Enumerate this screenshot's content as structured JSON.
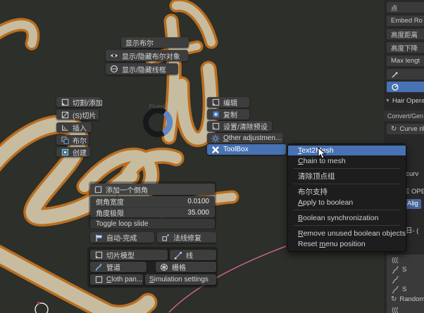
{
  "colors": {
    "highlight_blue": "#4772b3",
    "letter_cream": "#d5c8a9",
    "letter_orange": "#c8741f",
    "pink_curve": "#cb6287",
    "pie_arc_blue": "#5d87c6"
  },
  "pie": {
    "label": "Fluent菜单"
  },
  "top_buttons": [
    {
      "label": "显示布尔",
      "icon": null
    },
    {
      "label": "显示/隐藏布尔对象",
      "icon": "eye-icon"
    },
    {
      "label": "显示/隐藏线框",
      "icon": "wire-circle-icon"
    }
  ],
  "left_menu": [
    {
      "label": "切割/添加",
      "icon": "cut-add-icon"
    },
    {
      "label": "(S)切片",
      "icon": "slice-icon"
    },
    {
      "label": "插入",
      "icon": "inset-icon"
    },
    {
      "label": "布尔",
      "icon": "boolean-icon"
    },
    {
      "label": "创建",
      "icon": "create-icon"
    }
  ],
  "mid_menu": [
    {
      "label": "编辑",
      "icon": "edit-icon"
    },
    {
      "label": "复制",
      "icon": "duplicate-icon"
    },
    {
      "label": "设置/清除预设",
      "icon": "preset-icon"
    },
    {
      "label": "Other adjustmen...",
      "icon": "gear-icon",
      "accel": "O"
    },
    {
      "label": "ToolBox",
      "icon": "toolbox-icon",
      "highlighted": true
    }
  ],
  "submenu": [
    {
      "type": "item",
      "label": "Text2Mesh",
      "accel": "T",
      "highlighted": true
    },
    {
      "type": "item",
      "label": "Chain to mesh",
      "accel": "C"
    },
    {
      "type": "sep"
    },
    {
      "type": "item",
      "label": "清除顶点组"
    },
    {
      "type": "sep"
    },
    {
      "type": "item",
      "label": "布尔支持"
    },
    {
      "type": "item",
      "label": "Apply to boolean",
      "accel": "A"
    },
    {
      "type": "sep"
    },
    {
      "type": "item",
      "label": "Boolean synchronization",
      "accel": "B"
    },
    {
      "type": "sep"
    },
    {
      "type": "item",
      "label": "Remove unused boolean objects",
      "accel": "R"
    },
    {
      "type": "item",
      "label": "Reset menu position",
      "accel": "m"
    }
  ],
  "bevel_panel": {
    "title": "添加一个倒角",
    "title_icon": "bevel-icon",
    "props": [
      {
        "label": "倒角宽度",
        "value": "0.0100"
      },
      {
        "label": "角度极限",
        "value": "35.000"
      }
    ],
    "toggle": {
      "label": "Toggle loop slide",
      "accel": "g"
    }
  },
  "action_buttons": [
    {
      "label": "自动-完成",
      "icon": "flag-icon"
    },
    {
      "label": "法线修复",
      "icon": "normal-fix-icon"
    }
  ],
  "tool_buttons": [
    {
      "label": "切片模型",
      "icon": "slice-model-icon"
    },
    {
      "label": "线",
      "icon": "line-icon"
    },
    {
      "label": "管道",
      "icon": "pipe-icon"
    },
    {
      "label": "栅格",
      "icon": "lattice-icon"
    },
    {
      "label": "Cloth pan...",
      "icon": "cloth-icon",
      "accel": "C"
    },
    {
      "label": "Simulation settings",
      "accel": "S"
    }
  ],
  "right_panel": {
    "top_buttons": [
      "点",
      "Embed Ro",
      "高度距离",
      "高度下降",
      "Max lengt"
    ],
    "brush_rows": [
      {
        "icon": "comb-brush-icon",
        "selected": false
      },
      {
        "icon": "cut-brush-icon",
        "selected": true
      }
    ],
    "section_header": "Hair Opera",
    "sub_header": "Convert/Gen",
    "convert_button": {
      "label": "Curve rib",
      "icon": "refresh-icon"
    },
    "partials": [
      {
        "label": "t curv"
      },
      {
        "label": "E OPER"
      },
      {
        "label": "Alig"
      },
      {
        "label": "日- ("
      }
    ],
    "hair_rows": [
      {
        "icon": "wave-icon",
        "label": ""
      },
      {
        "icon": "strand-icon",
        "label": "S"
      },
      {
        "icon": "strand-icon",
        "label": ""
      },
      {
        "icon": "strand-icon",
        "label": "S"
      },
      {
        "icon": "random-icon",
        "label": "Random"
      },
      {
        "icon": "wave-icon",
        "label": ""
      }
    ]
  }
}
